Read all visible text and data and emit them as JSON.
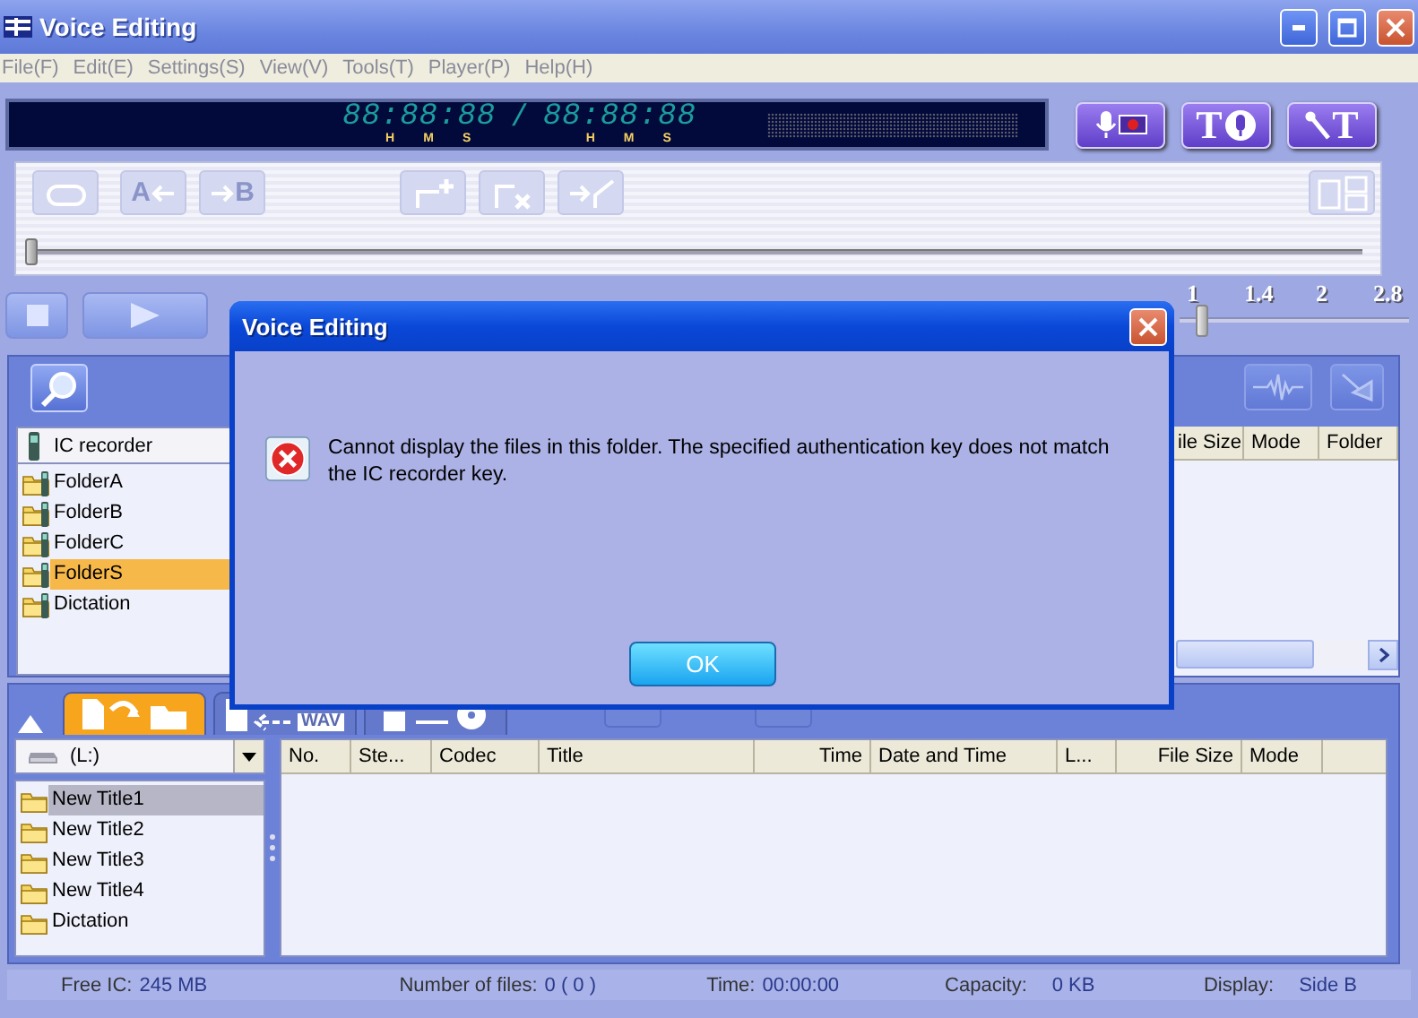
{
  "window": {
    "title": "Voice Editing"
  },
  "menu": [
    "File(F)",
    "Edit(E)",
    "Settings(S)",
    "View(V)",
    "Tools(T)",
    "Player(P)",
    "Help(H)"
  ],
  "display": {
    "elapsed": "88:88:88",
    "separator": "/",
    "total": "88:88:88",
    "units": [
      "H",
      "M",
      "S",
      "H",
      "M",
      "S"
    ]
  },
  "record_buttons": [
    {
      "kind": "record"
    },
    {
      "kind": "text_mic",
      "label": "T"
    },
    {
      "kind": "mic_text",
      "label": "T"
    }
  ],
  "edit_tools": [
    {
      "kind": "repeat",
      "disabled": true
    },
    {
      "kind": "mark_a",
      "label": "A",
      "disabled": true
    },
    {
      "kind": "mark_b",
      "label": "B",
      "disabled": true
    },
    {
      "kind": "add_mark",
      "disabled": true
    },
    {
      "kind": "erase_mark",
      "disabled": true
    },
    {
      "kind": "move_mark",
      "disabled": true
    },
    {
      "kind": "divide",
      "disabled": true
    }
  ],
  "position_slider": {
    "level": 0
  },
  "transport": [
    {
      "kind": "stop"
    },
    {
      "kind": "play"
    }
  ],
  "speed_scale": {
    "ticks": [
      "1",
      "1.4",
      "2",
      "2.8"
    ],
    "level": 0.07
  },
  "upper_pane": {
    "device": "IC recorder",
    "folders": [
      {
        "label": "FolderA",
        "selected": false
      },
      {
        "label": "FolderB",
        "selected": false
      },
      {
        "label": "FolderC",
        "selected": false
      },
      {
        "label": "FolderS",
        "selected": true
      },
      {
        "label": "Dictation",
        "selected": false
      }
    ],
    "columns": [
      "ile Size",
      "Mode",
      "Folder"
    ]
  },
  "lower_pane": {
    "tabs": [
      {
        "kind": "copy",
        "selected": true
      },
      {
        "kind": "wav",
        "label": "WAV",
        "selected": false
      },
      {
        "kind": "cd",
        "selected": false
      }
    ],
    "drive": "(L:)",
    "folders": [
      {
        "label": "New Title1",
        "selected": true
      },
      {
        "label": "New Title2",
        "selected": false
      },
      {
        "label": "New Title3",
        "selected": false
      },
      {
        "label": "New Title4",
        "selected": false
      },
      {
        "label": "Dictation",
        "selected": false
      }
    ],
    "columns": [
      "No.",
      "Ste...",
      "Codec",
      "Title",
      "Time",
      "Date and Time",
      "L...",
      "File Size",
      "Mode"
    ]
  },
  "status_bar": [
    {
      "label": "Free IC:",
      "value": "245 MB"
    },
    {
      "label": "Number of files:",
      "value": "0 ( 0 )"
    },
    {
      "label": "Time:",
      "value": "00:00:00"
    },
    {
      "label": "Capacity:",
      "value": "0 KB"
    },
    {
      "label": "Display:",
      "value": "Side B"
    }
  ],
  "dialog": {
    "title": "Voice Editing",
    "message": "Cannot display the files in this folder. The specified authentication key does not match the IC recorder key.",
    "button": "OK"
  }
}
